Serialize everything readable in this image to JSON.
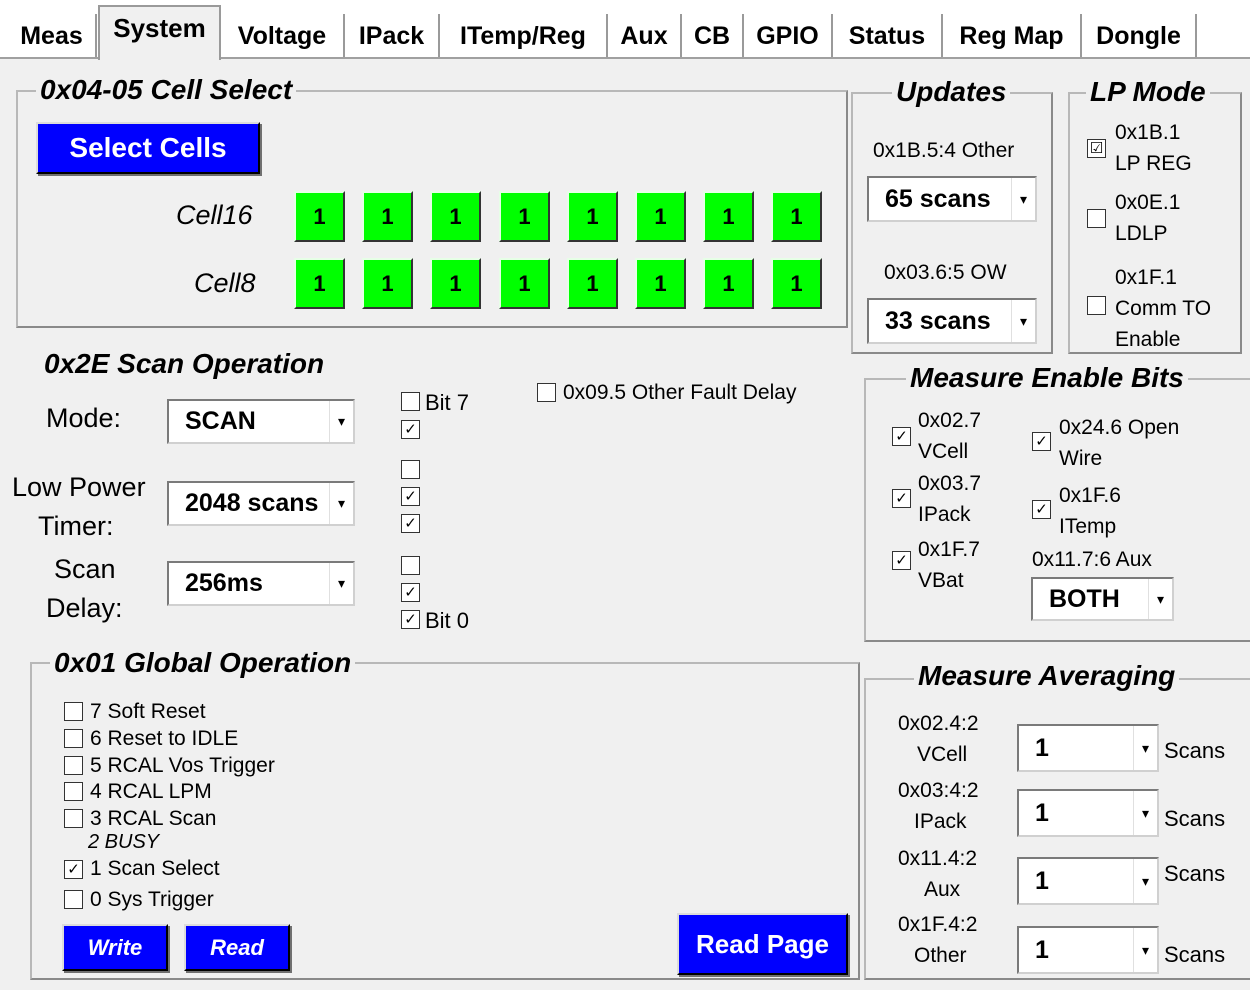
{
  "tabs": [
    "Meas",
    "System",
    "Voltage",
    "IPack",
    "ITemp/Reg",
    "Aux",
    "CB",
    "GPIO",
    "Status",
    "Reg Map",
    "Dongle"
  ],
  "cell_select": {
    "title": "0x04-05 Cell Select",
    "button": "Select Cells",
    "row1_label": "Cell16",
    "row2_label": "Cell8",
    "row1_values": [
      "1",
      "1",
      "1",
      "1",
      "1",
      "1",
      "1",
      "1"
    ],
    "row2_values": [
      "1",
      "1",
      "1",
      "1",
      "1",
      "1",
      "1",
      "1"
    ]
  },
  "updates": {
    "title": "Updates",
    "other_label": "0x1B.5:4 Other",
    "other_value": "65 scans",
    "ow_label": "0x03.6:5 OW",
    "ow_value": "33 scans"
  },
  "lp_mode": {
    "title": "LP Mode",
    "lp_reg": {
      "line1": "0x1B.1",
      "line2": "LP REG",
      "checked": "☑"
    },
    "ldlp": {
      "line1": "0x0E.1",
      "line2": "LDLP"
    },
    "comm_to": {
      "line1": "0x1F.1",
      "line2": "Comm TO",
      "line3": "Enable"
    }
  },
  "scan_op": {
    "title": "0x2E Scan Operation",
    "mode_label": "Mode:",
    "mode_value": "SCAN",
    "lp_timer_line1": "Low Power",
    "lp_timer_line2": "Timer:",
    "lp_timer_value": "2048 scans",
    "scan_delay_line1": "Scan",
    "scan_delay_line2": "Delay:",
    "scan_delay_value": "256ms",
    "bit7": "Bit 7",
    "bit0": "Bit 0",
    "fault_delay": "0x09.5 Other Fault Delay"
  },
  "measure_enable": {
    "title": "Measure Enable Bits",
    "vcell": {
      "line1": "0x02.7",
      "line2": "VCell"
    },
    "ipack": {
      "line1": "0x03.7",
      "line2": "IPack"
    },
    "vbat": {
      "line1": "0x1F.7",
      "line2": "VBat"
    },
    "open_wire": {
      "line1": "0x24.6 Open",
      "line2": "Wire"
    },
    "itemp": {
      "line1": "0x1F.6",
      "line2": "ITemp"
    },
    "aux_label": "0x11.7:6 Aux",
    "aux_value": "BOTH"
  },
  "global_op": {
    "title": "0x01 Global Operation",
    "items": [
      "7 Soft Reset",
      "6 Reset to IDLE",
      "5 RCAL Vos Trigger",
      "4 RCAL LPM",
      "3 RCAL Scan"
    ],
    "busy": "2 BUSY",
    "scan_select": "1 Scan Select",
    "sys_trigger": "0 Sys Trigger",
    "write": "Write",
    "read": "Read",
    "read_page": "Read Page"
  },
  "averaging": {
    "title": "Measure Averaging",
    "rows": [
      {
        "reg": "0x02.4:2",
        "name": "VCell",
        "value": "1",
        "unit": "Scans"
      },
      {
        "reg": "0x03:4:2",
        "name": "IPack",
        "value": "1",
        "unit": "Scans"
      },
      {
        "reg": "0x11.4:2",
        "name": "Aux",
        "value": "1",
        "unit": "Scans"
      },
      {
        "reg": "0x1F.4:2",
        "name": "Other",
        "value": "1",
        "unit": "Scans"
      }
    ]
  },
  "check_mark": "✓",
  "arrow": "▾",
  "colors": {
    "accent_blue": "#0000ff",
    "cell_green": "#00ff00",
    "background": "#f0f0f0"
  }
}
